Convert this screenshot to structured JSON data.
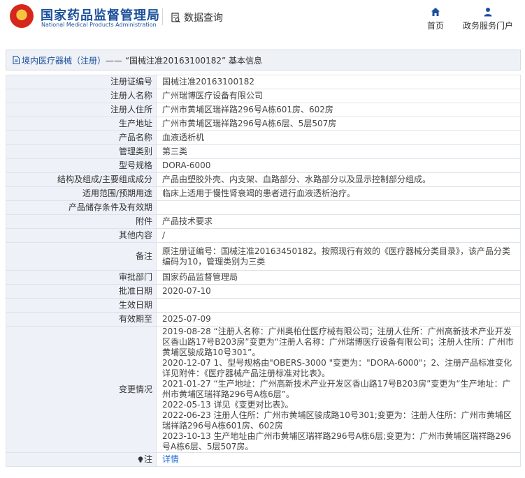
{
  "header": {
    "brand_cn": "国家药品监督管理局",
    "brand_en": "National Medical Products Administration",
    "query_label": "数据查询",
    "nav": [
      {
        "label": "首页",
        "icon": "home-icon"
      },
      {
        "label": "政务服务门户",
        "icon": "user-icon"
      }
    ]
  },
  "page": {
    "title_link": "境内医疗器械（注册）",
    "title_rest": " —— “国械注准20163100182” 基本信息"
  },
  "rows": [
    {
      "label": "注册证编号",
      "value": "国械注准20163100182"
    },
    {
      "label": "注册人名称",
      "value": "广州瑞博医疗设备有限公司"
    },
    {
      "label": "注册人住所",
      "value": "广州市黄埔区瑞祥路296号A栋601房、602房"
    },
    {
      "label": "生产地址",
      "value": "广州市黄埔区瑞祥路296号A栋6层、5层507房"
    },
    {
      "label": "产品名称",
      "value": "血液透析机"
    },
    {
      "label": "管理类别",
      "value": "第三类"
    },
    {
      "label": "型号规格",
      "value": "DORA-6000"
    },
    {
      "label": "结构及组成/主要组成成分",
      "value": "产品由塑胶外壳、内支架、血路部分、水路部分以及显示控制部分组成。"
    },
    {
      "label": "适用范围/预期用途",
      "value": "临床上适用于慢性肾衰竭的患者进行血液透析治疗。"
    },
    {
      "label": "产品储存条件及有效期",
      "value": ""
    },
    {
      "label": "附件",
      "value": "产品技术要求"
    },
    {
      "label": "其他内容",
      "value": "/"
    },
    {
      "label": "备注",
      "value": "原注册证编号：国械注准20163450182。按照现行有效的《医疗器械分类目录》，该产品分类编码为10，管理类别为三类"
    },
    {
      "label": "审批部门",
      "value": "国家药品监督管理局"
    },
    {
      "label": "批准日期",
      "value": "2020-07-10"
    },
    {
      "label": "生效日期",
      "value": ""
    },
    {
      "label": "有效期至",
      "value": "2025-07-09"
    }
  ],
  "changes": {
    "label": "变更情况",
    "lines": [
      "2019-08-28 “注册人名称：广州奥柏仕医疗械有限公司；注册人住所：广州高新技术产业开发区香山路17号B203房”变更为“注册人名称：广州瑞博医疗设备有限公司；注册人住所：广州市黄埔区骏成路10号301”。",
      "2020-12-07 1、型号规格由\"OBERS-3000 \"变更为：\"DORA-6000\"；2、注册产品标准变化详见附件：《医疗器械产品注册标准对比表》。",
      "2021-01-27 “生产地址：广州高新技术产业开发区香山路17号B203房”变更为“生产地址：广州市黄埔区瑞祥路296号A栋6层”。",
      "2022-05-13 详见《变更对比表》。",
      "2022-06-23 注册人住所：广州市黄埔区骏成路10号301;变更为：注册人住所：广州市黄埔区瑞祥路296号A栋601房、602房",
      "2023-10-13 生产地址由广州市黄埔区瑞祥路296号A栋6层;变更为：广州市黄埔区瑞祥路296号A栋6层、5层507房。"
    ]
  },
  "note": {
    "label": "注",
    "value": "详情"
  }
}
